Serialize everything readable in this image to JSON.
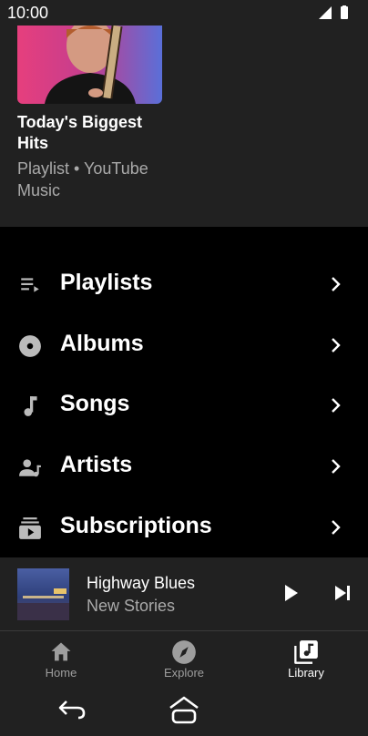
{
  "status_bar": {
    "time": "10:00"
  },
  "recent_card": {
    "title": "Today's Biggest Hits",
    "subtitle": "Playlist • YouTube Music"
  },
  "library": {
    "items": [
      {
        "label": "Playlists",
        "icon": "playlist-icon"
      },
      {
        "label": "Albums",
        "icon": "album-icon"
      },
      {
        "label": "Songs",
        "icon": "music-note-icon"
      },
      {
        "label": "Artists",
        "icon": "artist-icon"
      },
      {
        "label": "Subscriptions",
        "icon": "subscriptions-icon"
      }
    ]
  },
  "now_playing": {
    "title": "Highway Blues",
    "artist": "New Stories"
  },
  "bottom_nav": {
    "items": [
      {
        "label": "Home",
        "icon": "home-icon",
        "active": false
      },
      {
        "label": "Explore",
        "icon": "compass-icon",
        "active": false
      },
      {
        "label": "Library",
        "icon": "library-icon",
        "active": true
      }
    ]
  },
  "colors": {
    "surface": "#212121",
    "background": "#000000",
    "secondary_text": "#aaaaaa"
  }
}
